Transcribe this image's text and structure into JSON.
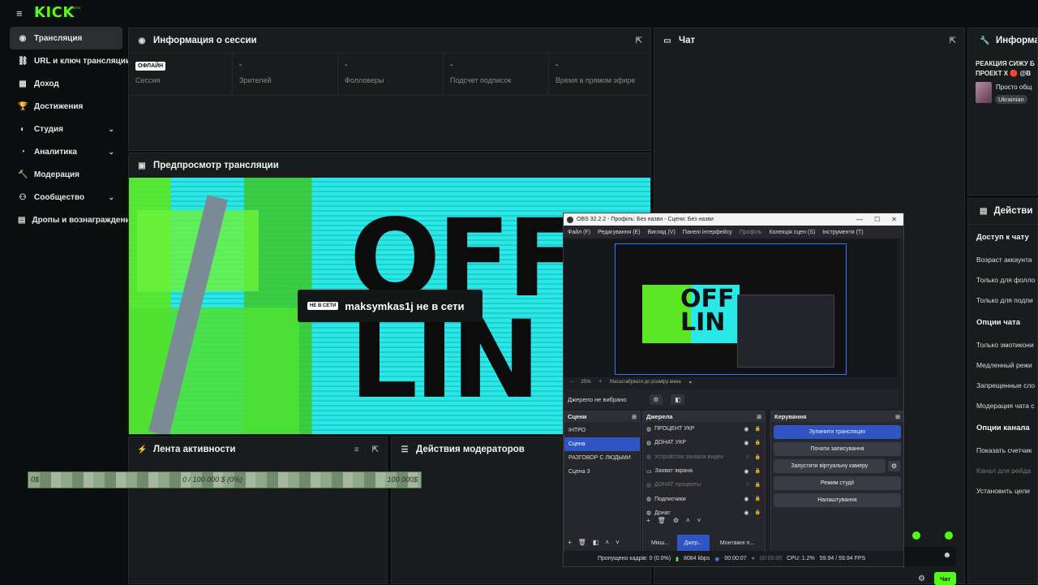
{
  "brand": {
    "logo": "KICK",
    "beta": "BETA"
  },
  "sidebar": {
    "items": [
      {
        "label": "Трансляция",
        "icon": "broadcast-icon",
        "active": true
      },
      {
        "label": "URL и ключ трансляции",
        "icon": "link-icon"
      },
      {
        "label": "Доход",
        "icon": "money-icon"
      },
      {
        "label": "Достижения",
        "icon": "trophy-icon"
      },
      {
        "label": "Студия",
        "icon": "studio-icon",
        "chevron": true
      },
      {
        "label": "Аналитика",
        "icon": "analytics-icon",
        "chevron": true
      },
      {
        "label": "Модерация",
        "icon": "hammer-icon"
      },
      {
        "label": "Сообщество",
        "icon": "community-icon",
        "chevron": true
      },
      {
        "label": "Дропы и вознаграждения",
        "icon": "gift-icon"
      }
    ]
  },
  "session": {
    "title": "Информация о сессии",
    "badge": "ОФЛАЙН",
    "stats": [
      {
        "label": "Сессия",
        "value": ""
      },
      {
        "label": "Зрителей",
        "value": "-"
      },
      {
        "label": "Фолловеры",
        "value": "-"
      },
      {
        "label": "Подсчет подписок",
        "value": "-"
      },
      {
        "label": "Время в прямом эфире",
        "value": "-"
      }
    ]
  },
  "chat": {
    "title": "Чат",
    "send": "Чат"
  },
  "info": {
    "title": "Информа",
    "stream_title": "РЕАКЦИЯ СИЖУ Б ПРОЕКТ X 🔴 @B",
    "category": "Просто общ",
    "tag": "Ukrainian"
  },
  "actions": {
    "title": "Действи",
    "chat_access": "Доступ к чату",
    "items1": [
      "Возраст аккаунта",
      "Только для фолло",
      "Только для подпи"
    ],
    "chat_opts": "Опции чата",
    "items2": [
      "Только эмотикони",
      "Медленный режи",
      "Запрещенные сло",
      "Модерация чата с"
    ],
    "channel_opts": "Опции канала",
    "items3": [
      "Показать счетчик",
      "Канал для рейда",
      "Установить цели"
    ]
  },
  "preview": {
    "title": "Предпросмотр трансляции",
    "badge": "НЕ В СЕТИ",
    "status": "maksymkas1j не в сети",
    "big": "OFF LIN"
  },
  "activity": {
    "title": "Лента активности"
  },
  "mods": {
    "title": "Действия модераторов"
  },
  "goal_bar": {
    "left": "0$",
    "mid": "0 / 100 000 $ (0%)",
    "right": "100 000$",
    "progress": 0
  },
  "obs": {
    "title": "OBS 32.2.2 - Профіль: Без назви - Сцени: Без назви",
    "menu": [
      "Файл (F)",
      "Редагування (E)",
      "Вигляд (V)",
      "Панелі інтерфейсу",
      "Профіль",
      "Колекція сцен (S)",
      "Інструменти (T)"
    ],
    "zoom": "25%",
    "zoom_mode": "Масштабувати до розміру вікна",
    "no_source": "Джерело не вибрано",
    "scenes_h": "Сцени",
    "scenes": [
      "ІНТРО",
      "Сцена",
      "РАЗГОВОР С ЛЮДЬМИ",
      "Сцена 3"
    ],
    "sources_h": "Джерела",
    "sources": [
      {
        "name": "ПРОЦЕНТ УКР",
        "dim": false
      },
      {
        "name": "ДОНАТ УКР",
        "dim": false
      },
      {
        "name": "Устройство захвата видео",
        "dim": true
      },
      {
        "name": "Захват экрана",
        "dim": false
      },
      {
        "name": "ДОНАТ проценты",
        "dim": true
      },
      {
        "name": "Подписчики",
        "dim": false
      },
      {
        "name": "Донат",
        "dim": false
      }
    ],
    "controls_h": "Керування",
    "controls": [
      "Зупинити трансляцію",
      "Почати записування",
      "Запустити віртуальну камеру",
      "Режим студії",
      "Налаштування"
    ],
    "tabs": [
      "Мікш...",
      "Джер...",
      "Монтажні п..."
    ],
    "status": {
      "dropped": "Пропущено кадрів: 0 (0.0%)",
      "kbps": "8084 kbps",
      "live": "00:00:07",
      "rec": "00:00:00",
      "cpu": "CPU: 1.2%",
      "fps": "59.94 / 59.94 FPS"
    }
  },
  "colors": {
    "kick_green": "#53fc18",
    "obs_blue": "#2f55c4"
  }
}
